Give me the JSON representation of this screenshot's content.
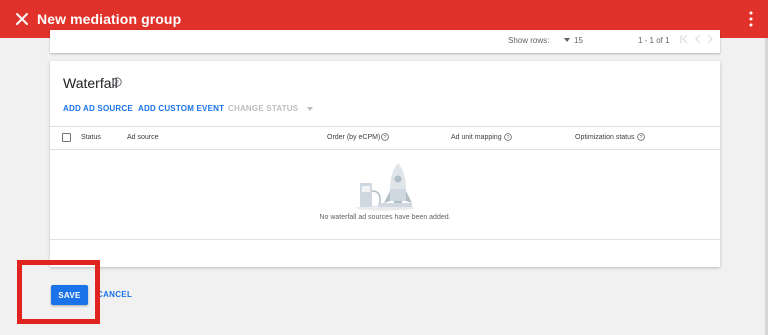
{
  "appbar": {
    "title": "New mediation group",
    "close_icon": "close-icon",
    "more_icon": "more-vert-icon",
    "color": "#e0322a"
  },
  "previous_card": {
    "rows_label": "Show rows:",
    "rows_value": "15",
    "range": "1 - 1 of 1"
  },
  "waterfall": {
    "title": "Waterfall",
    "actions": {
      "add_ad_source": "ADD AD SOURCE",
      "add_custom_event": "ADD CUSTOM EVENT",
      "change_status": "CHANGE STATUS"
    },
    "columns": {
      "status": "Status",
      "ad_source": "Ad source",
      "order": "Order (by eCPM)",
      "ad_unit_mapping": "Ad unit mapping",
      "optimization_status": "Optimization status"
    },
    "empty_message": "No waterfall ad sources have been added."
  },
  "footer": {
    "save_label": "SAVE",
    "cancel_label": "CANCEL"
  },
  "colors": {
    "accent_blue": "#1a73e8",
    "highlight_red": "#e0231f"
  }
}
